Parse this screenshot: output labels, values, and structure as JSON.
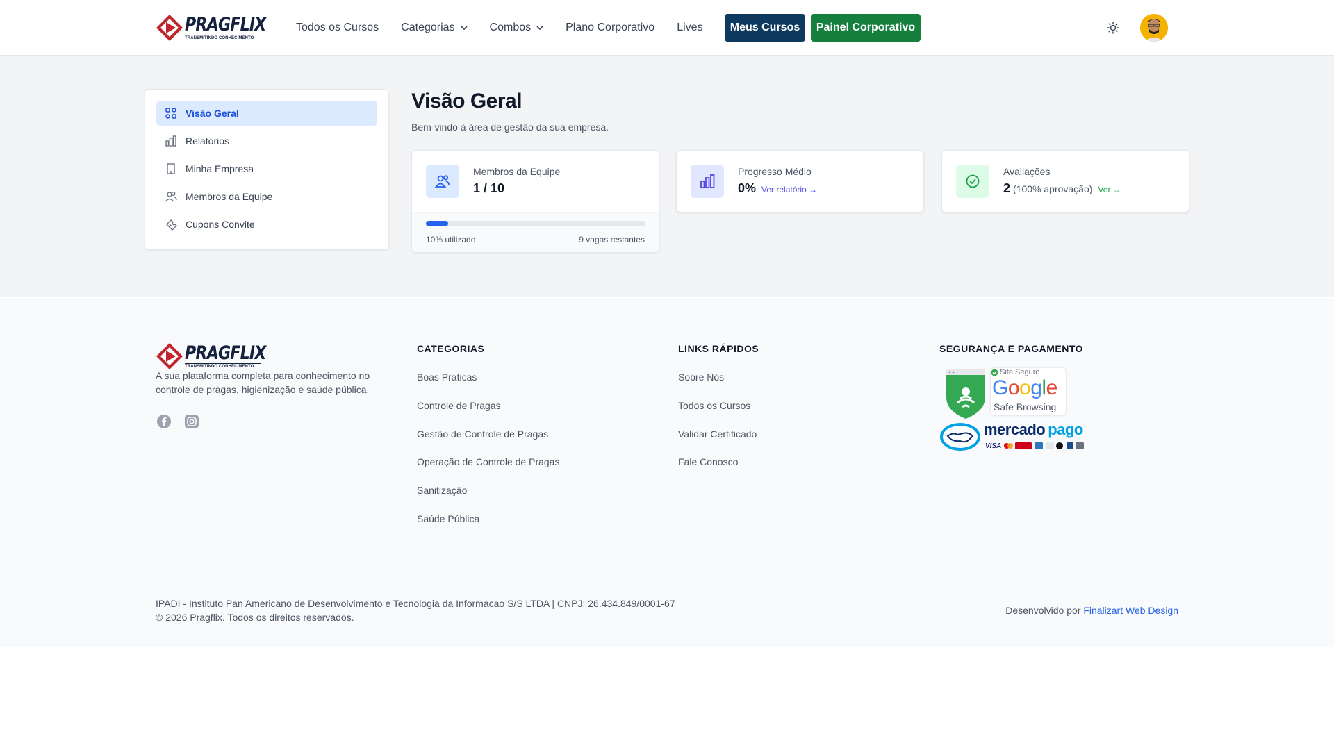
{
  "brand": {
    "name": "PRAGFLIX",
    "tagline": "TRANSMITINDO CONHECIMENTO"
  },
  "header": {
    "nav": [
      {
        "label": "Todos os Cursos",
        "dropdown": false
      },
      {
        "label": "Categorias",
        "dropdown": true
      },
      {
        "label": "Combos",
        "dropdown": true
      },
      {
        "label": "Plano Corporativo",
        "dropdown": false
      },
      {
        "label": "Lives",
        "dropdown": false
      }
    ],
    "meus_cursos": "Meus Cursos",
    "painel": "Painel Corporativo",
    "theme_icon": "sun-icon",
    "avatar_icon": "user-avatar"
  },
  "sidebar": {
    "items": [
      {
        "label": "Visão Geral",
        "icon": "grid-icon",
        "active": true
      },
      {
        "label": "Relatórios",
        "icon": "bar-chart-icon",
        "active": false
      },
      {
        "label": "Minha Empresa",
        "icon": "building-icon",
        "active": false
      },
      {
        "label": "Membros da Equipe",
        "icon": "users-icon",
        "active": false
      },
      {
        "label": "Cupons Convite",
        "icon": "ticket-icon",
        "active": false
      }
    ]
  },
  "main": {
    "title": "Visão Geral",
    "subtitle": "Bem-vindo à área de gestão da sua empresa.",
    "cards": {
      "members": {
        "label": "Membros da Equipe",
        "value": "1 / 10",
        "progress": 0.1,
        "used": "10% utilizado",
        "remaining": "9 vagas restantes"
      },
      "progress": {
        "label": "Progresso Médio",
        "value": "0%",
        "link": "Ver relatório →"
      },
      "ratings": {
        "label": "Avaliações",
        "value": "2",
        "extra": "(100% aprovação)",
        "link": "Ver →"
      }
    }
  },
  "footer": {
    "description": "A sua plataforma completa para conhecimento no controle de pragas, higienização e saúde pública.",
    "social": [
      "facebook-icon",
      "instagram-icon"
    ],
    "categories": {
      "title": "CATEGORIAS",
      "links": [
        "Boas Práticas",
        "Controle de Pragas",
        "Gestão de Controle de Pragas",
        "Operação de Controle de Pragas",
        "Sanitização",
        "Saúde Pública"
      ]
    },
    "quick_links": {
      "title": "LINKS RÁPIDOS",
      "links": [
        "Sobre Nós",
        "Todos os Cursos",
        "Validar Certificado",
        "Fale Conosco"
      ]
    },
    "security": {
      "title": "SEGURANÇA E PAGAMENTO",
      "safe_label": "Site Seguro",
      "google": "Google",
      "safe_browsing": "Safe Browsing",
      "mercado": "mercado",
      "pago": "pago",
      "cards": "VISA"
    },
    "legal": "IPADI - Instituto Pan Americano de Desenvolvimento e Tecnologia da Informacao S/S LTDA | CNPJ: 26.434.849/0001-67",
    "copyright": "© 2026 Pragflix. Todos os direitos reservados.",
    "dev_prefix": "Desenvolvido por",
    "dev_link": "Finalizart Web Design"
  },
  "colors": {
    "primary_blue": "#0f3a5f",
    "green": "#15803d",
    "accent": "#2563eb",
    "brand_red": "#c0262d"
  }
}
